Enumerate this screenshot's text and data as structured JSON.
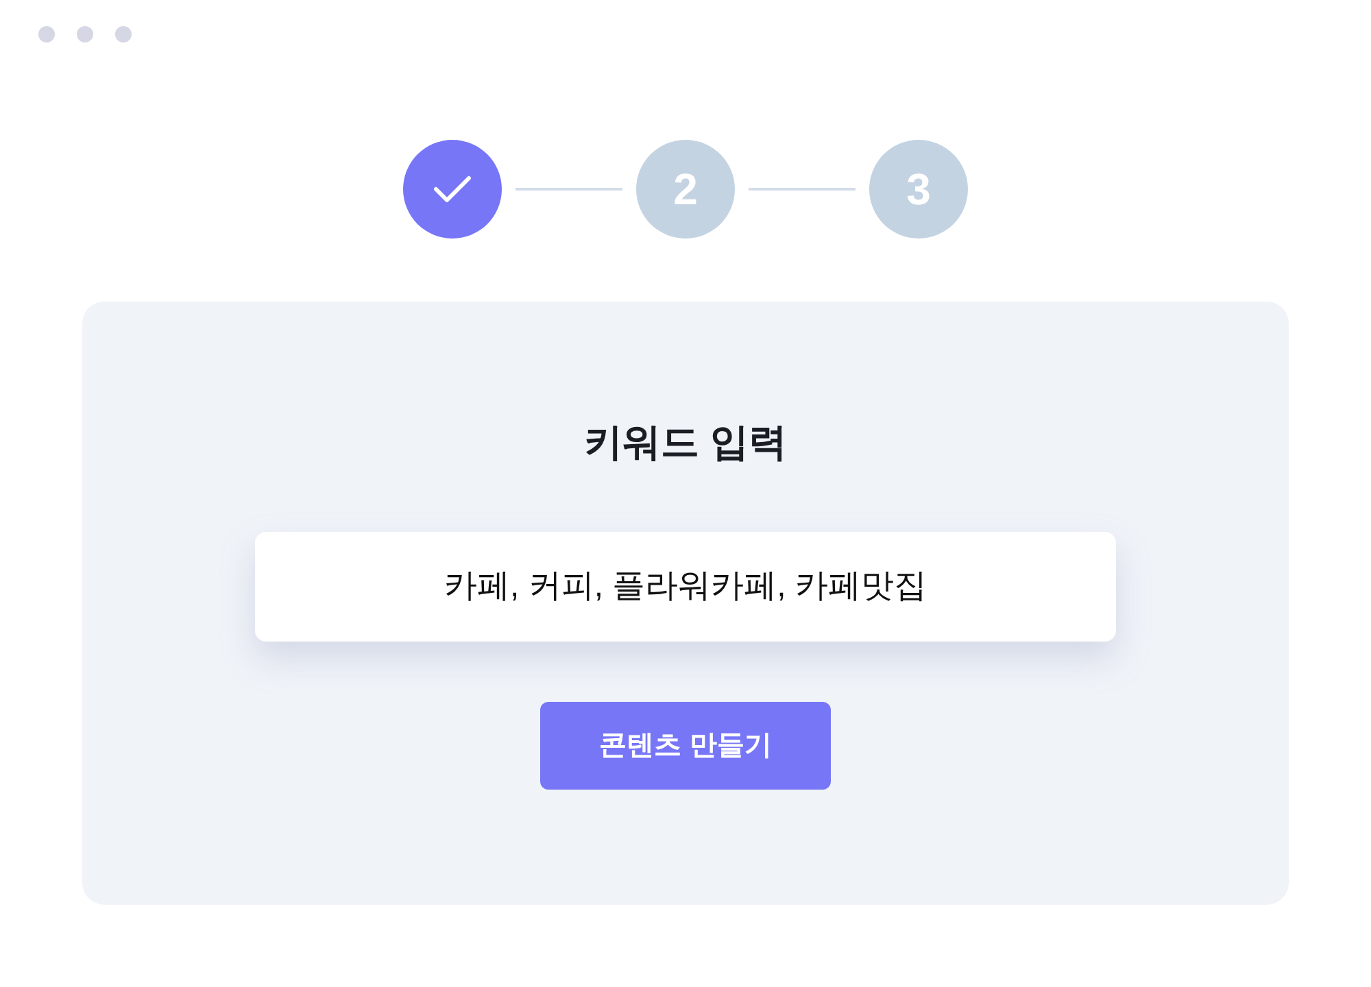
{
  "steps": [
    {
      "completed": true
    },
    {
      "completed": false,
      "label": "2"
    },
    {
      "completed": false,
      "label": "3"
    }
  ],
  "card": {
    "title": "키워드 입력",
    "keyword_field": {
      "value": "카페, 커피, 플라워카페, 카페맛집"
    },
    "button": "콘텐츠 만들기"
  }
}
